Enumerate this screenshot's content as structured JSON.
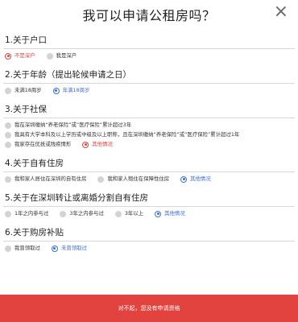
{
  "dialog": {
    "title": "我可以申请公租房吗？",
    "close_icon": "×"
  },
  "sections": [
    {
      "title": "1.关于户口",
      "options": [
        {
          "label": "不是深户",
          "selected": true,
          "color": "#e0433f"
        },
        {
          "label": "我是深户",
          "selected": false
        }
      ]
    },
    {
      "title": "2.关于年龄（提出轮候申请之日）",
      "options": [
        {
          "label": "未满18周岁",
          "selected": false
        },
        {
          "label": "年满18周岁",
          "selected": true,
          "color": "#3b6fd8"
        }
      ]
    },
    {
      "title": "3.关于社保",
      "options": [
        {
          "label": "我在深圳缴纳“养老保险”或“医疗保险”累计超过3年",
          "selected": false
        },
        {
          "label": "我具有大学本科及以上学历或中级及以上职称，且在深圳缴纳“养老保险”或“医疗保险”累计超过1年",
          "selected": false
        },
        {
          "label": "我家存在优抚或残疾情形",
          "selected": false
        },
        {
          "label": "其他情况",
          "selected": true,
          "color": "#e0433f"
        }
      ]
    },
    {
      "title": "4.关于自有住房",
      "options": [
        {
          "label": "我和家人居住在深圳的自有住房",
          "selected": false
        },
        {
          "label": "我和家人租住在保障性住房",
          "selected": false
        },
        {
          "label": "其他情况",
          "selected": true,
          "color": "#3b6fd8"
        }
      ]
    },
    {
      "title": "5.关于在深圳转让或离婚分割自有住房",
      "options": [
        {
          "label": "1年之内参与过",
          "selected": false
        },
        {
          "label": "3年之内参与过",
          "selected": false
        },
        {
          "label": "3年以上",
          "selected": false
        },
        {
          "label": "其他情况",
          "selected": true,
          "color": "#3b6fd8"
        }
      ]
    },
    {
      "title": "6.关于购房补贴",
      "options": [
        {
          "label": "我曾领取过",
          "selected": false
        },
        {
          "label": "未曾领取过",
          "selected": true,
          "color": "#3b6fd8"
        }
      ]
    }
  ],
  "footer": {
    "result_text": "对不起，您没有申请资格",
    "color": "#e2433f"
  }
}
